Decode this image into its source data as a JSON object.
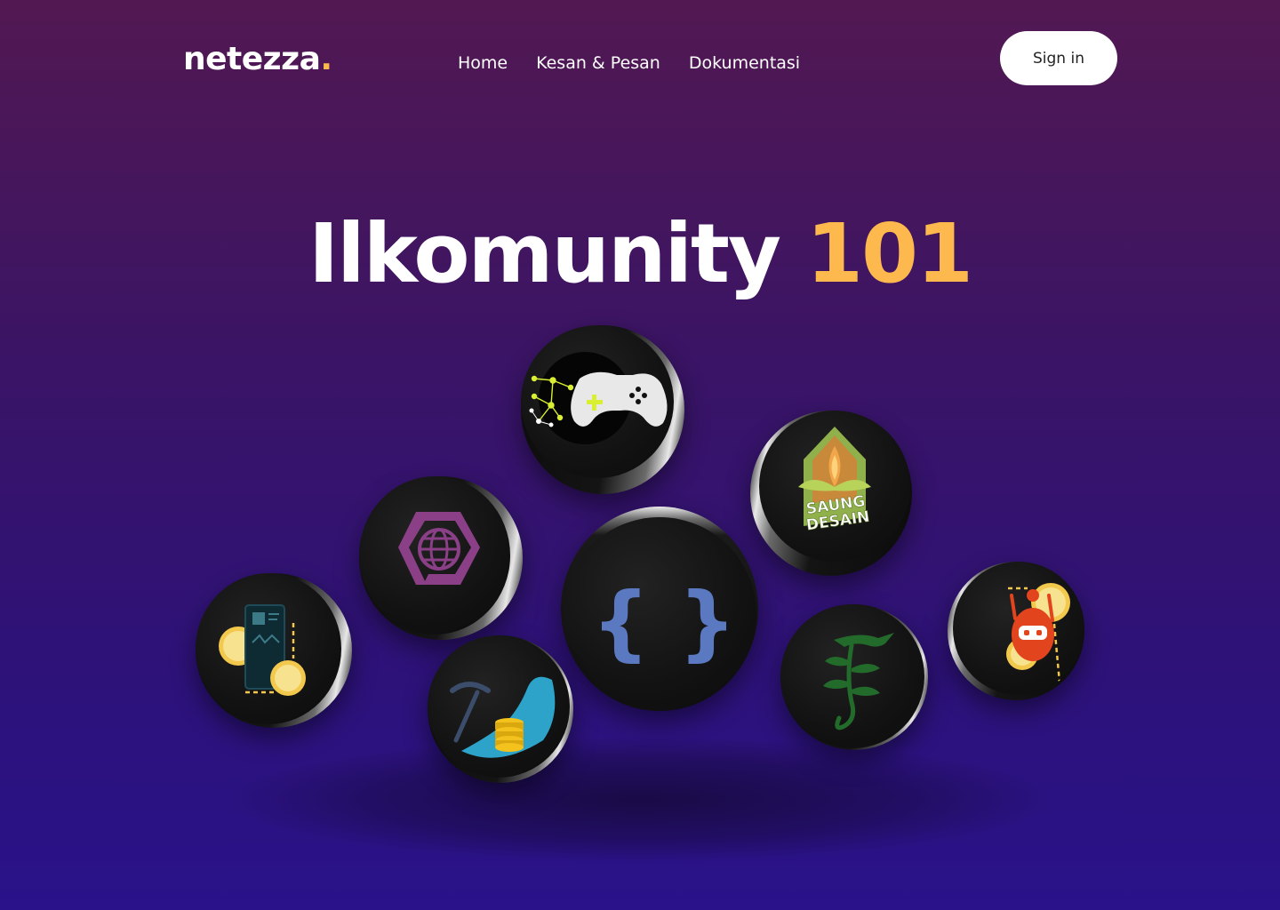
{
  "header": {
    "logo_text": "netezza",
    "logo_dot": ".",
    "nav": [
      {
        "label": "Home"
      },
      {
        "label": "Kesan & Pesan"
      },
      {
        "label": "Dokumentasi"
      }
    ],
    "signin_label": "Sign in"
  },
  "hero": {
    "title_main": "Ilkomunity",
    "title_accent": "101"
  },
  "badges": [
    {
      "icon": "game-controller-icon"
    },
    {
      "icon": "saung-desain-icon",
      "text_line1": "SAUNG",
      "text_line2": "DESAIN"
    },
    {
      "icon": "globe-hexagon-icon"
    },
    {
      "icon": "curly-braces-icon",
      "text": "{ }"
    },
    {
      "icon": "mobile-app-icon"
    },
    {
      "icon": "data-mining-icon"
    },
    {
      "icon": "dragon-plant-icon"
    },
    {
      "icon": "robot-icon"
    }
  ],
  "colors": {
    "accent": "#fdb94d",
    "background_top": "#521852",
    "background_bottom": "#29128a",
    "button_bg": "#ffffff"
  }
}
